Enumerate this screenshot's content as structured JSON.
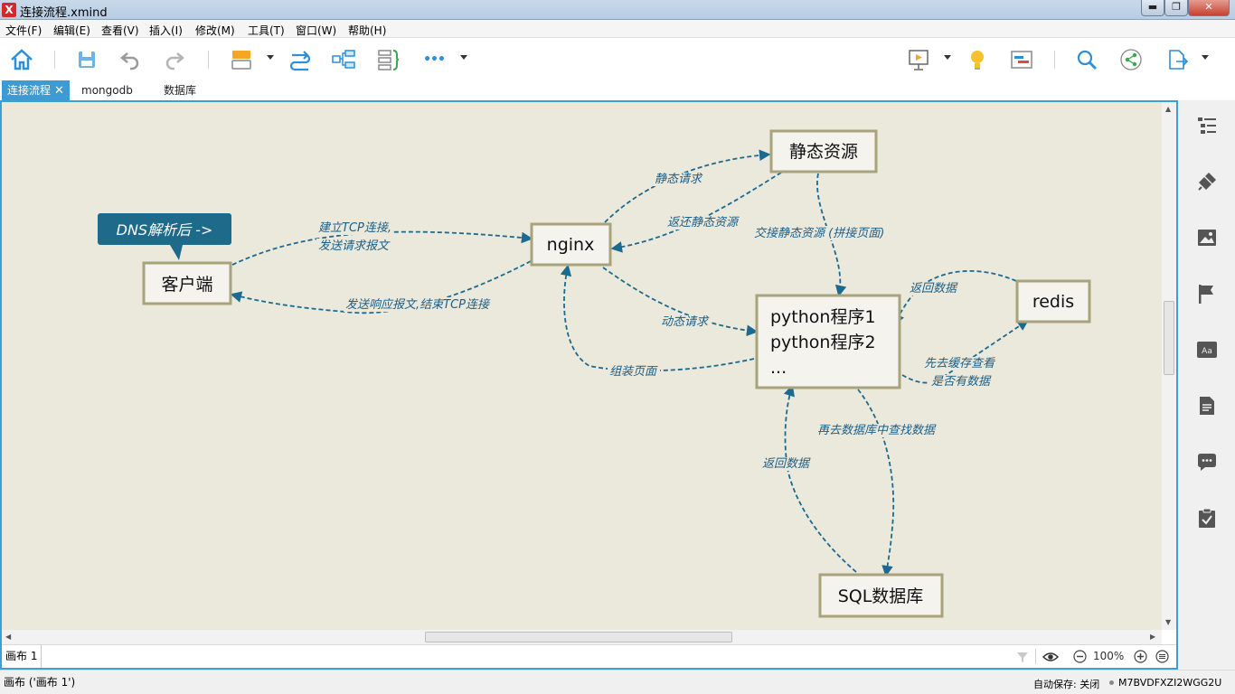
{
  "window": {
    "title": "连接流程.xmind",
    "app_logo": "X",
    "min_icon": "minimize-icon",
    "max_icon": "maximize-icon",
    "close_icon": "close-icon",
    "min_glyph": "▬",
    "max_glyph": "❐",
    "close_glyph": "✕"
  },
  "menu": {
    "items": [
      "文件(F)",
      "编辑(E)",
      "查看(V)",
      "插入(I)",
      "修改(M)",
      "工具(T)",
      "窗口(W)",
      "帮助(H)"
    ]
  },
  "toolbar": {
    "icons": [
      "home-icon",
      "save-icon",
      "undo-icon",
      "redo-icon",
      "topic-icon",
      "relationship-icon",
      "summary-structure-icon",
      "boundary-icon",
      "more-icon",
      "presentation-icon",
      "idea-icon",
      "gantt-icon",
      "search-icon",
      "share-icon",
      "export-icon"
    ],
    "more_glyph": "•••"
  },
  "tabs": {
    "items": [
      "连接流程",
      "mongodb",
      "数据库"
    ],
    "close_glyph": "✕"
  },
  "mindmap": {
    "callout": "DNS解析后 ->",
    "nodes": {
      "client": "客户端",
      "nginx": "nginx",
      "static": "静态资源",
      "python_lines": [
        "python程序1",
        "python程序2",
        "..."
      ],
      "redis": "redis",
      "sql": "SQL数据库"
    },
    "edges": {
      "client_to_nginx": [
        "建立TCP连接,",
        "发送请求报文"
      ],
      "nginx_to_client": "发送响应报文,结束TCP连接",
      "nginx_to_static": "静态请求",
      "static_to_nginx": "返还静态资源",
      "static_to_python": "交接静态资源 (拼接页面)",
      "nginx_to_python": "动态请求",
      "python_to_nginx": "组装页面",
      "redis_to_python": "返回数据",
      "python_to_redis": [
        "先去缓存查看",
        "是否有数据"
      ],
      "python_to_sql": "再去数据库中查找数据",
      "sql_to_python": "返回数据"
    },
    "colors": {
      "background": "#ebe8dc",
      "node_border": "#a8a37c",
      "edge": "#1c6a8f",
      "callout": "#1d6a8a"
    }
  },
  "scroll": {
    "up_glyph": "▲",
    "down_glyph": "▼",
    "left_glyph": "◀",
    "right_glyph": "▶"
  },
  "sheetbar": {
    "sheet_label": "画布 1",
    "zoom": "100%",
    "icons": [
      "filter-icon",
      "eye-icon",
      "zoom-out-icon",
      "zoom-in-icon",
      "menu-icon"
    ]
  },
  "rightpanel": {
    "icons": [
      "outline-icon",
      "format-brush-icon",
      "image-icon",
      "marker-flag-icon",
      "font-icon",
      "notes-icon",
      "comment-icon",
      "task-icon"
    ]
  },
  "status": {
    "left": "画布 ('画布 1')",
    "autosave": "自动保存: 关闭",
    "license": "M7BVDFXZI2WGG2U"
  }
}
